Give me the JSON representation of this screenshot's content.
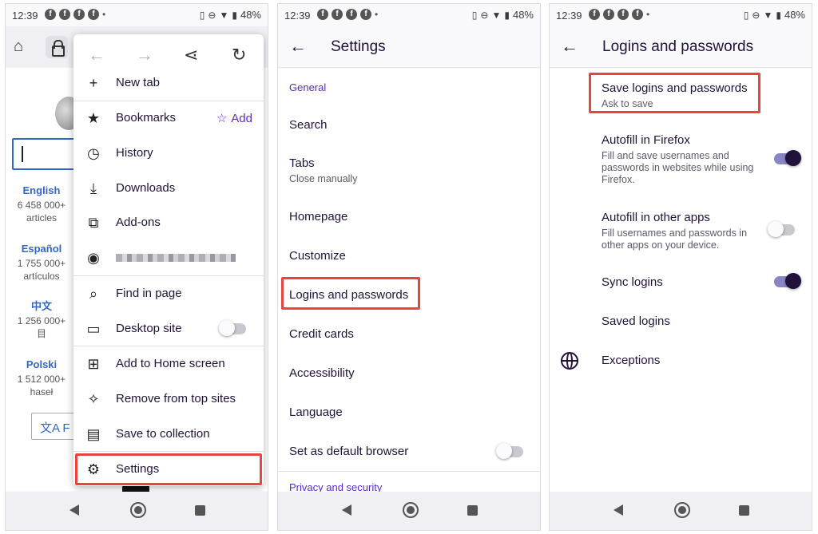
{
  "status": {
    "time": "12:39",
    "notification_icons": [
      "f",
      "f",
      "f",
      "f"
    ],
    "dot": "•",
    "battery_percent": "48%"
  },
  "panel1": {
    "wiki": {
      "languages": [
        {
          "name": "English",
          "count": "6 458 000+",
          "unit": "articles"
        },
        {
          "name": "Español",
          "count": "1 755 000+",
          "unit": "artículos"
        },
        {
          "name": "中文",
          "count": "1 256 000+",
          "unit": "目"
        },
        {
          "name": "Polski",
          "count": "1 512 000+",
          "unit": "haseł"
        }
      ],
      "translate_label": "文A F"
    },
    "menu": {
      "items": [
        {
          "label": "New tab",
          "icon": "plus-icon"
        },
        {
          "label": "Bookmarks",
          "icon": "star-icon",
          "action": "Add"
        },
        {
          "label": "History",
          "icon": "clock-icon"
        },
        {
          "label": "Downloads",
          "icon": "download-icon"
        },
        {
          "label": "Add-ons",
          "icon": "puzzle-icon"
        },
        {
          "label": "",
          "icon": "account-icon"
        },
        {
          "label": "Find in page",
          "icon": "search-icon"
        },
        {
          "label": "Desktop site",
          "icon": "laptop-icon",
          "toggle": false
        },
        {
          "label": "Add to Home screen",
          "icon": "add-to-home-icon"
        },
        {
          "label": "Remove from top sites",
          "icon": "unpin-icon"
        },
        {
          "label": "Save to collection",
          "icon": "collection-icon"
        },
        {
          "label": "Settings",
          "icon": "gear-icon"
        }
      ]
    }
  },
  "panel2": {
    "title": "Settings",
    "section_general": "General",
    "items": [
      {
        "label": "Search",
        "sub": ""
      },
      {
        "label": "Tabs",
        "sub": "Close manually"
      },
      {
        "label": "Homepage",
        "sub": ""
      },
      {
        "label": "Customize",
        "sub": ""
      },
      {
        "label": "Logins and passwords",
        "sub": ""
      },
      {
        "label": "Credit cards",
        "sub": ""
      },
      {
        "label": "Accessibility",
        "sub": ""
      },
      {
        "label": "Language",
        "sub": ""
      },
      {
        "label": "Set as default browser",
        "sub": "",
        "toggle": false
      }
    ],
    "section_privacy": "Privacy and security"
  },
  "panel3": {
    "title": "Logins and passwords",
    "items": [
      {
        "label": "Save logins and passwords",
        "sub": "Ask to save"
      },
      {
        "label": "Autofill in Firefox",
        "sub": "Fill and save usernames and passwords in websites while using Firefox.",
        "toggle": true
      },
      {
        "label": "Autofill in other apps",
        "sub": "Fill usernames and passwords in other apps on your device.",
        "toggle": false
      },
      {
        "label": "Sync logins",
        "sub": "",
        "toggle": true
      },
      {
        "label": "Saved logins",
        "sub": ""
      },
      {
        "label": "Exceptions",
        "sub": "",
        "icon": "globe-icon"
      }
    ]
  },
  "colors": {
    "accent": "#592acb",
    "highlight": "#e8463c",
    "toggle_on": "#20123a"
  }
}
